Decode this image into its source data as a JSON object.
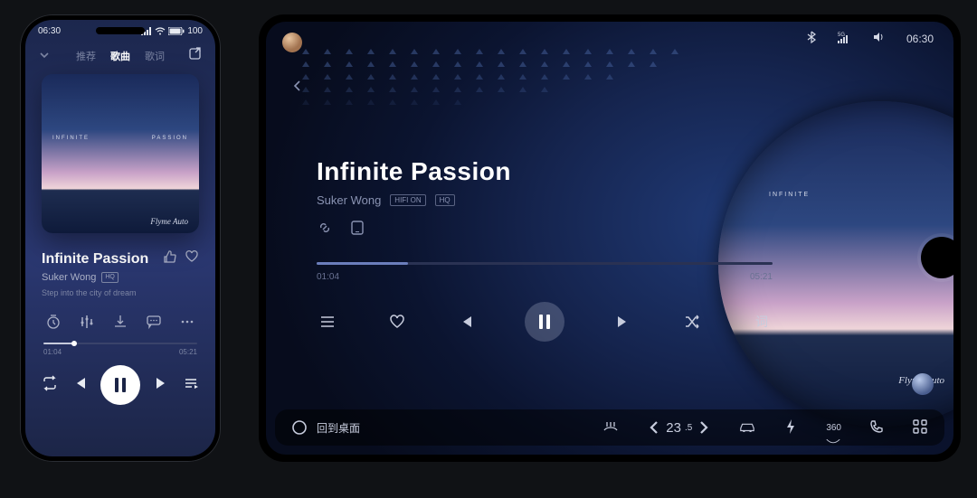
{
  "phone": {
    "status": {
      "time": "06:30",
      "battery": "100"
    },
    "tabs": {
      "t1": "推荐",
      "t2": "歌曲",
      "t3": "歌词"
    },
    "album": {
      "word1": "INFINITE",
      "word2": "PASSION",
      "brand": "Flyme Auto"
    },
    "track": {
      "title": "Infinite Passion",
      "artist": "Suker Wong",
      "quality": "HQ",
      "lyric": "Step into the city of dream"
    },
    "progress": {
      "elapsed": "01:04",
      "total": "05:21"
    }
  },
  "tablet": {
    "status": {
      "time": "06:30"
    },
    "track": {
      "title": "Infinite Passion",
      "artist": "Suker Wong",
      "badge1": "HIFI ON",
      "badge2": "HQ"
    },
    "progress": {
      "elapsed": "01:04",
      "total": "05:21"
    },
    "lyrics_button": "词",
    "disc": {
      "word1": "INFINITE",
      "brand": "Flyme Auto"
    },
    "dock": {
      "home": "回到桌面",
      "temp_value": "23",
      "temp_decimal": ".5",
      "cam": "360"
    }
  }
}
